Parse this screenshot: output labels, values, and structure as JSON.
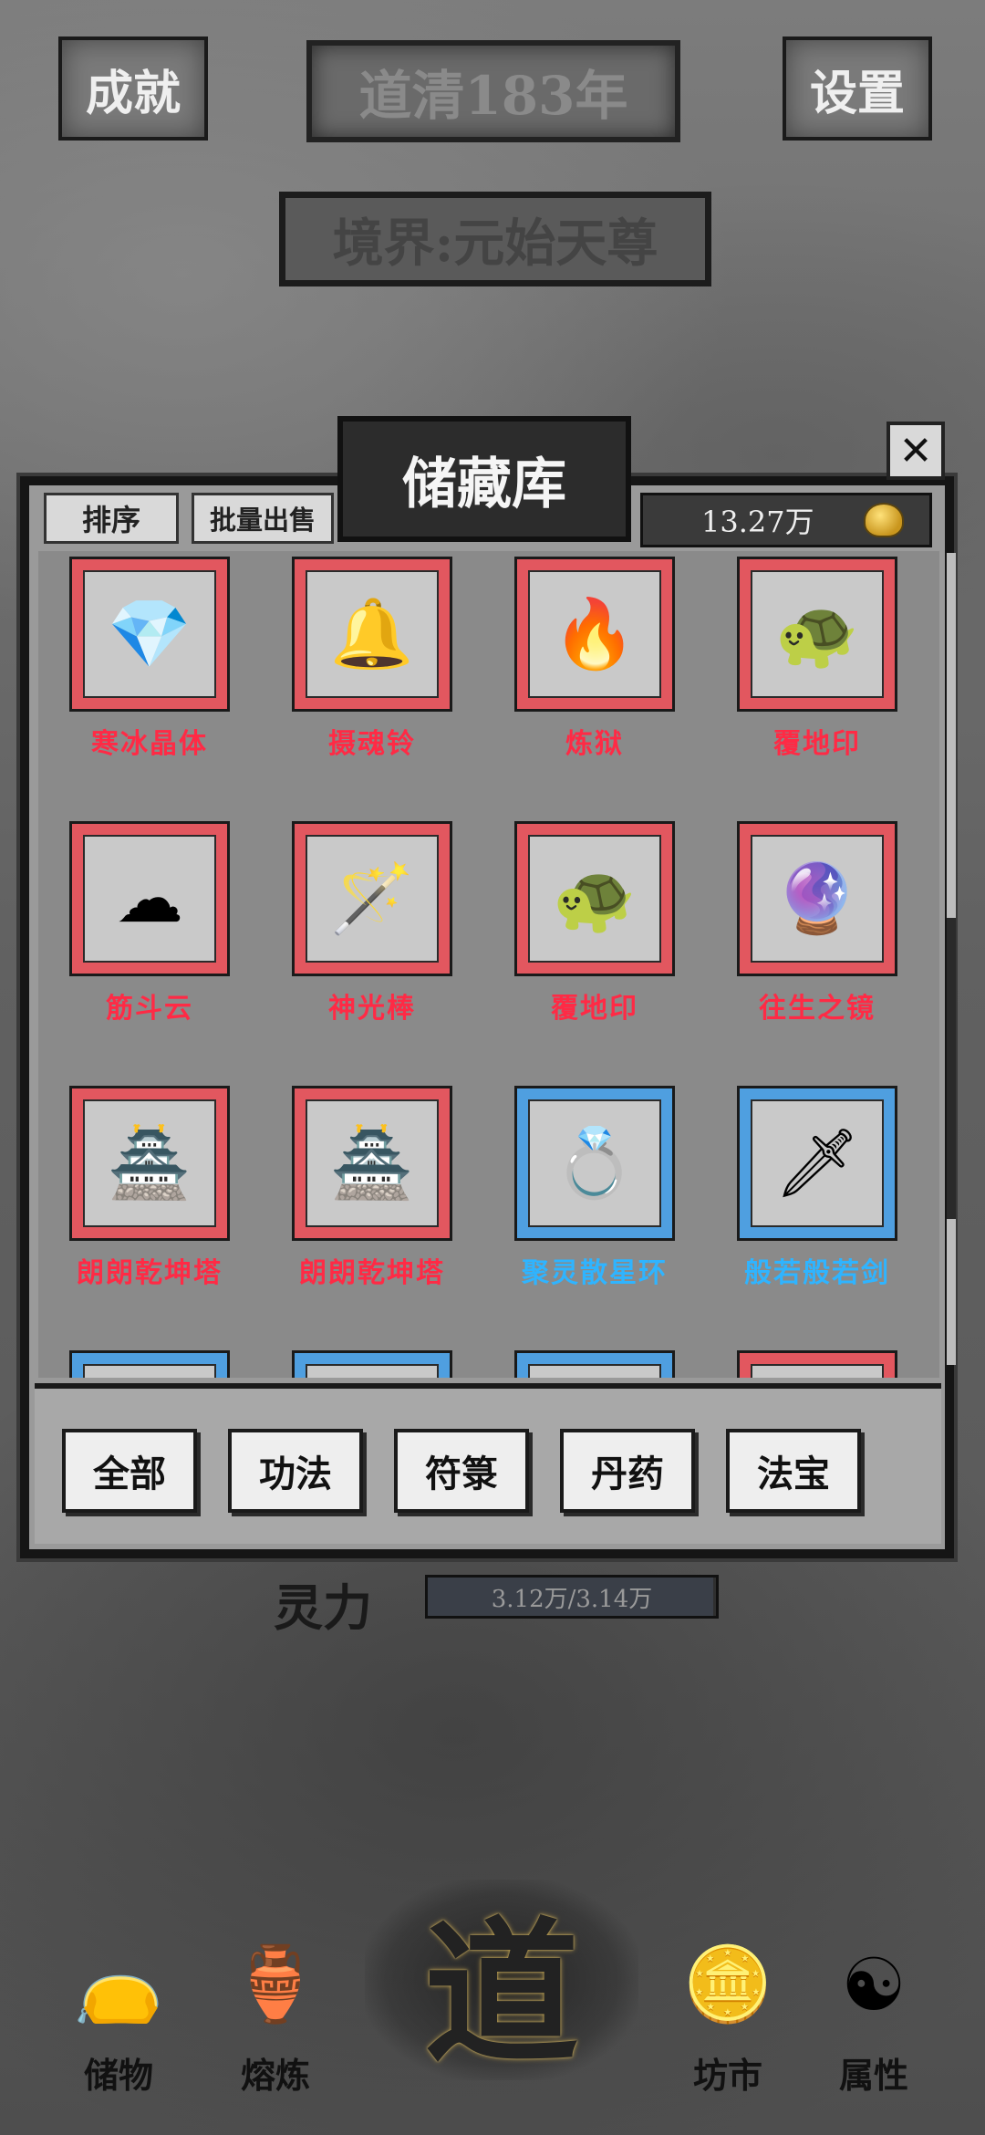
{
  "top_bar": {
    "achievements_label": "成就",
    "year_label": "道清183年",
    "settings_label": "设置"
  },
  "realm_label": "境界:元始天尊",
  "storage": {
    "title": "储藏库",
    "sort_label": "排序",
    "bulk_sell_label": "批量出售",
    "currency_value": "13.27万",
    "currency_icon": "coin-icon",
    "items": [
      {
        "name": "寒冰晶体",
        "rarity": "red",
        "icon": "ice-crystal-icon",
        "glyph": "💎"
      },
      {
        "name": "摄魂铃",
        "rarity": "red",
        "icon": "bell-icon",
        "glyph": "🔔"
      },
      {
        "name": "炼狱",
        "rarity": "red",
        "icon": "fire-icon",
        "glyph": "🔥"
      },
      {
        "name": "覆地印",
        "rarity": "red",
        "icon": "turtle-seal-icon",
        "glyph": "🐢"
      },
      {
        "name": "筋斗云",
        "rarity": "red",
        "icon": "cloud-icon",
        "glyph": "☁"
      },
      {
        "name": "神光棒",
        "rarity": "red",
        "icon": "staff-icon",
        "glyph": "🪄"
      },
      {
        "name": "覆地印",
        "rarity": "red",
        "icon": "turtle-seal-icon",
        "glyph": "🐢"
      },
      {
        "name": "往生之镜",
        "rarity": "red",
        "icon": "mirror-icon",
        "glyph": "🔮"
      },
      {
        "name": "朗朗乾坤塔",
        "rarity": "red",
        "icon": "pagoda-icon",
        "glyph": "🏯"
      },
      {
        "name": "朗朗乾坤塔",
        "rarity": "red",
        "icon": "pagoda-icon",
        "glyph": "🏯"
      },
      {
        "name": "聚灵散星环",
        "rarity": "blue",
        "icon": "ring-icon",
        "glyph": "💍"
      },
      {
        "name": "般若般若剑",
        "rarity": "blue",
        "icon": "sword-icon",
        "glyph": "🗡"
      },
      {
        "name": "",
        "rarity": "blue",
        "icon": "sickle-icon",
        "glyph": "⚔"
      },
      {
        "name": "",
        "rarity": "blue",
        "icon": "thunder-orb-icon",
        "glyph": "🌀"
      },
      {
        "name": "",
        "rarity": "blue",
        "icon": "ribbon-icon",
        "glyph": "〰"
      },
      {
        "name": "",
        "rarity": "red",
        "icon": "staff-icon",
        "glyph": "🪄"
      }
    ],
    "tabs": [
      "全部",
      "功法",
      "符箓",
      "丹药",
      "法宝"
    ]
  },
  "spirit": {
    "label": "灵力",
    "value_text": "3.12万/3.14万",
    "fill_fraction": 0.99
  },
  "bottom_nav": {
    "storage_label": "储物",
    "refine_label": "熔炼",
    "center_char": "道",
    "market_label": "坊市",
    "attributes_label": "属性"
  },
  "colors": {
    "rarity_red": "#e2575f",
    "rarity_blue": "#4f9fe0",
    "name_red": "#ff2a45",
    "name_blue": "#2fb4ff"
  }
}
